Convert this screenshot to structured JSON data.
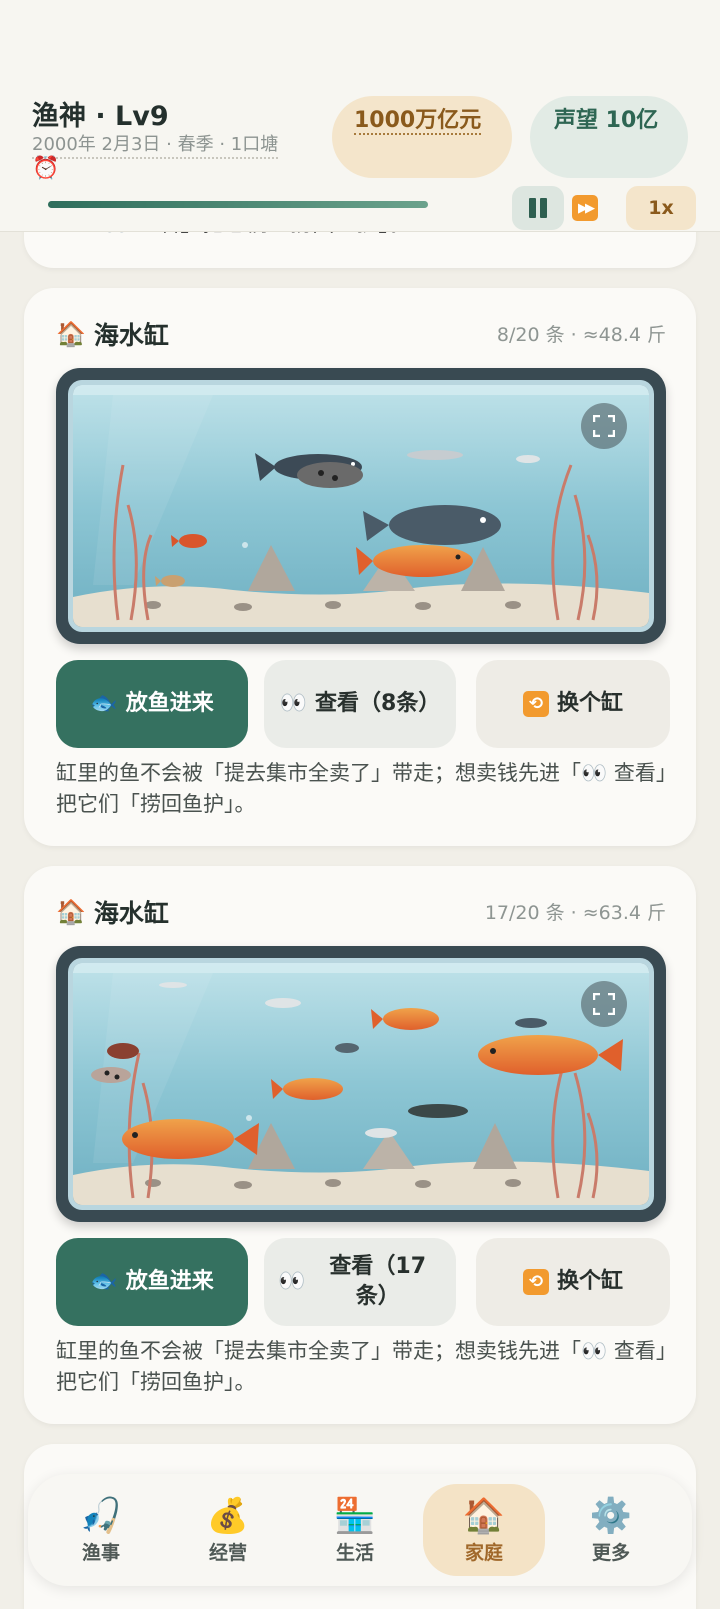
{
  "header": {
    "title": "渔神 · Lv9",
    "date": "2000年 2月3日 · 春季 · 1口塘",
    "money": "1000万亿元",
    "fame": "声望 10亿",
    "speed": "1x",
    "progress": 1.0
  },
  "top_card_partial_text": "「👀 查看」把它们「捞回鱼护」。",
  "tanks": [
    {
      "title": "海水缸",
      "meta": "8/20 条 · ≈48.4 斤",
      "release_label": "放鱼进来",
      "view_label": "查看（8条）",
      "swap_label": "换个缸",
      "note": "缸里的鱼不会被「提去集市全卖了」带走；想卖钱先进「👀 查看」把它们「捞回鱼护」。"
    },
    {
      "title": "海水缸",
      "meta": "17/20 条 · ≈63.4 斤",
      "release_label": "放鱼进来",
      "view_label": "查看（17条）",
      "swap_label": "换个缸",
      "note": "缸里的鱼不会被「提去集市全卖了」带走；想卖钱先进「👀 查看」把它们「捞回鱼护」。"
    }
  ],
  "nav": [
    {
      "label": "渔事",
      "icon": "fishing-icon"
    },
    {
      "label": "经营",
      "icon": "money-bag-icon"
    },
    {
      "label": "生活",
      "icon": "store-icon"
    },
    {
      "label": "家庭",
      "icon": "house-icon",
      "active": true
    },
    {
      "label": "更多",
      "icon": "gear-icon"
    }
  ],
  "colors": {
    "accent": "#357160",
    "money_bg": "#f4e5cb",
    "fame_bg": "#e2ebe5",
    "background": "#f1efe8"
  }
}
